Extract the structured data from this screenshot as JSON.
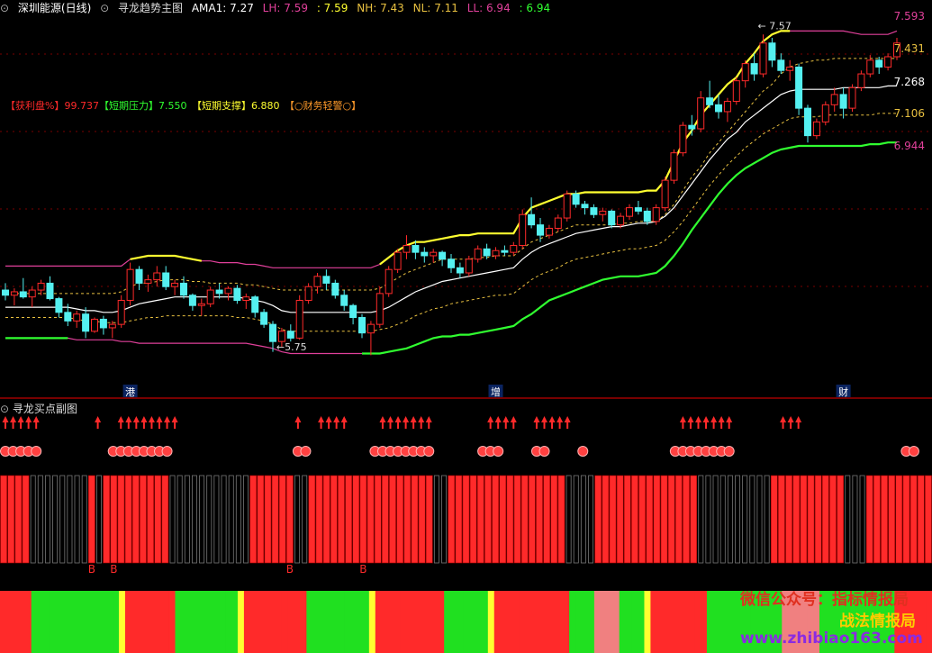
{
  "header": {
    "stock_name": "深圳能源",
    "period": "(日线)",
    "indicator_name": "寻龙趋势主图",
    "ama1_label": "AMA1:",
    "ama1_value": "7.27",
    "lh_label": "LH:",
    "lh_value": "7.59",
    "val2": ": 7.59",
    "nh_label": "NH:",
    "nh_value": "7.43",
    "nl_label": "NL:",
    "nl_value": "7.11",
    "ll_label": "LL:",
    "ll_value": "6.94",
    "val6": ": 6.94"
  },
  "indicators": {
    "profit_label": "【获利盘%】",
    "profit_value": "99.737",
    "pressure_label": "【短期压力】",
    "pressure_value": "7.550",
    "support_label": "【短期支撑】",
    "support_value": "6.880",
    "finance_label": "【○财务轻警○】"
  },
  "sub_panel": {
    "title": "寻龙买点副图"
  },
  "colors": {
    "up": "#ff2a2a",
    "down": "#54f0f0",
    "yellow": "#ffff30",
    "green": "#30ff30",
    "magenta": "#e0409a",
    "white": "#ffffff",
    "gold": "#e8c040",
    "pink": "#f08080",
    "darkred": "#a80000"
  },
  "chart_data": {
    "type": "candlestick",
    "price_range": [
      5.55,
      7.65
    ],
    "right_axis_labels": [
      "7.593",
      "7.431",
      "7.268",
      "7.106",
      "6.944"
    ],
    "annotations": [
      {
        "text": "7.57",
        "index": 85,
        "price": 7.62
      },
      {
        "text": "5.75",
        "index": 31,
        "price": 5.75
      }
    ],
    "event_markers": [
      {
        "text": "港",
        "index": 14
      },
      {
        "text": "增",
        "index": 55
      },
      {
        "text": "财",
        "index": 94
      }
    ],
    "ohlc": [
      [
        6.08,
        6.12,
        6.02,
        6.05
      ],
      [
        6.05,
        6.09,
        5.99,
        6.07
      ],
      [
        6.07,
        6.15,
        6.03,
        6.04
      ],
      [
        6.04,
        6.1,
        5.98,
        6.08
      ],
      [
        6.08,
        6.14,
        6.05,
        6.12
      ],
      [
        6.12,
        6.16,
        6.02,
        6.03
      ],
      [
        6.03,
        6.04,
        5.92,
        5.95
      ],
      [
        5.95,
        6.0,
        5.87,
        5.9
      ],
      [
        5.9,
        5.96,
        5.86,
        5.94
      ],
      [
        5.94,
        5.98,
        5.8,
        5.84
      ],
      [
        5.84,
        5.92,
        5.83,
        5.91
      ],
      [
        5.91,
        5.93,
        5.82,
        5.86
      ],
      [
        5.86,
        5.9,
        5.8,
        5.88
      ],
      [
        5.88,
        6.05,
        5.86,
        6.02
      ],
      [
        6.02,
        6.24,
        5.99,
        6.2
      ],
      [
        6.2,
        6.22,
        6.08,
        6.12
      ],
      [
        6.12,
        6.17,
        6.07,
        6.14
      ],
      [
        6.14,
        6.22,
        6.1,
        6.18
      ],
      [
        6.18,
        6.22,
        6.08,
        6.1
      ],
      [
        6.1,
        6.14,
        6.05,
        6.12
      ],
      [
        6.12,
        6.16,
        6.03,
        6.05
      ],
      [
        6.05,
        6.06,
        5.96,
        5.99
      ],
      [
        5.99,
        6.03,
        5.93,
        6.0
      ],
      [
        6.0,
        6.1,
        5.98,
        6.08
      ],
      [
        6.08,
        6.12,
        6.03,
        6.06
      ],
      [
        6.06,
        6.1,
        6.02,
        6.09
      ],
      [
        6.09,
        6.11,
        6.0,
        6.02
      ],
      [
        6.02,
        6.06,
        5.97,
        6.04
      ],
      [
        6.04,
        6.05,
        5.92,
        5.95
      ],
      [
        5.95,
        5.97,
        5.86,
        5.88
      ],
      [
        5.88,
        5.9,
        5.72,
        5.78
      ],
      [
        5.78,
        5.86,
        5.75,
        5.84
      ],
      [
        5.84,
        5.88,
        5.78,
        5.8
      ],
      [
        5.8,
        6.05,
        5.79,
        6.02
      ],
      [
        6.02,
        6.12,
        6.0,
        6.1
      ],
      [
        6.1,
        6.18,
        6.06,
        6.16
      ],
      [
        6.16,
        6.2,
        6.08,
        6.12
      ],
      [
        6.12,
        6.14,
        6.03,
        6.05
      ],
      [
        6.05,
        6.08,
        5.96,
        5.99
      ],
      [
        5.99,
        6.0,
        5.88,
        5.92
      ],
      [
        5.92,
        5.94,
        5.8,
        5.83
      ],
      [
        5.83,
        5.9,
        5.7,
        5.88
      ],
      [
        5.88,
        6.1,
        5.86,
        6.06
      ],
      [
        6.06,
        6.22,
        6.04,
        6.2
      ],
      [
        6.2,
        6.32,
        6.18,
        6.3
      ],
      [
        6.3,
        6.4,
        6.26,
        6.34
      ],
      [
        6.34,
        6.37,
        6.26,
        6.3
      ],
      [
        6.3,
        6.33,
        6.24,
        6.28
      ],
      [
        6.28,
        6.32,
        6.24,
        6.3
      ],
      [
        6.3,
        6.31,
        6.22,
        6.26
      ],
      [
        6.26,
        6.29,
        6.18,
        6.21
      ],
      [
        6.21,
        6.24,
        6.15,
        6.18
      ],
      [
        6.18,
        6.28,
        6.16,
        6.26
      ],
      [
        6.26,
        6.34,
        6.24,
        6.32
      ],
      [
        6.32,
        6.35,
        6.26,
        6.28
      ],
      [
        6.28,
        6.33,
        6.26,
        6.31
      ],
      [
        6.31,
        6.34,
        6.28,
        6.3
      ],
      [
        6.3,
        6.36,
        6.28,
        6.34
      ],
      [
        6.34,
        6.55,
        6.32,
        6.52
      ],
      [
        6.52,
        6.62,
        6.44,
        6.46
      ],
      [
        6.46,
        6.5,
        6.36,
        6.4
      ],
      [
        6.4,
        6.46,
        6.38,
        6.44
      ],
      [
        6.44,
        6.52,
        6.42,
        6.5
      ],
      [
        6.5,
        6.66,
        6.48,
        6.64
      ],
      [
        6.64,
        6.66,
        6.56,
        6.58
      ],
      [
        6.58,
        6.6,
        6.52,
        6.56
      ],
      [
        6.56,
        6.58,
        6.5,
        6.52
      ],
      [
        6.52,
        6.56,
        6.48,
        6.54
      ],
      [
        6.54,
        6.55,
        6.44,
        6.46
      ],
      [
        6.46,
        6.53,
        6.44,
        6.51
      ],
      [
        6.51,
        6.58,
        6.49,
        6.56
      ],
      [
        6.56,
        6.6,
        6.52,
        6.54
      ],
      [
        6.54,
        6.56,
        6.46,
        6.48
      ],
      [
        6.48,
        6.58,
        6.46,
        6.56
      ],
      [
        6.56,
        6.74,
        6.54,
        6.72
      ],
      [
        6.72,
        6.9,
        6.7,
        6.88
      ],
      [
        6.88,
        7.06,
        6.86,
        7.04
      ],
      [
        7.04,
        7.1,
        6.98,
        7.02
      ],
      [
        7.02,
        7.24,
        7.0,
        7.2
      ],
      [
        7.2,
        7.3,
        7.14,
        7.16
      ],
      [
        7.16,
        7.22,
        7.08,
        7.12
      ],
      [
        7.12,
        7.2,
        7.06,
        7.18
      ],
      [
        7.18,
        7.32,
        7.16,
        7.3
      ],
      [
        7.3,
        7.42,
        7.26,
        7.4
      ],
      [
        7.4,
        7.46,
        7.3,
        7.34
      ],
      [
        7.34,
        7.57,
        7.32,
        7.52
      ],
      [
        7.52,
        7.55,
        7.38,
        7.42
      ],
      [
        7.42,
        7.46,
        7.34,
        7.36
      ],
      [
        7.36,
        7.42,
        7.3,
        7.38
      ],
      [
        7.38,
        7.4,
        7.1,
        7.14
      ],
      [
        7.14,
        7.16,
        6.94,
        6.98
      ],
      [
        6.98,
        7.08,
        6.96,
        7.06
      ],
      [
        7.06,
        7.18,
        7.04,
        7.16
      ],
      [
        7.16,
        7.26,
        7.12,
        7.22
      ],
      [
        7.22,
        7.26,
        7.08,
        7.14
      ],
      [
        7.14,
        7.28,
        7.12,
        7.26
      ],
      [
        7.26,
        7.36,
        7.24,
        7.34
      ],
      [
        7.34,
        7.45,
        7.32,
        7.42
      ],
      [
        7.42,
        7.44,
        7.34,
        7.38
      ],
      [
        7.38,
        7.46,
        7.36,
        7.44
      ],
      [
        7.44,
        7.55,
        7.42,
        7.52
      ]
    ],
    "bands": {
      "lh": [
        6.22,
        6.22,
        6.22,
        6.22,
        6.22,
        6.22,
        6.22,
        6.22,
        6.22,
        6.22,
        6.22,
        6.22,
        6.22,
        6.22,
        6.26,
        6.27,
        6.28,
        6.28,
        6.28,
        6.28,
        6.27,
        6.26,
        6.25,
        6.25,
        6.24,
        6.24,
        6.24,
        6.23,
        6.23,
        6.22,
        6.21,
        6.21,
        6.21,
        6.21,
        6.21,
        6.21,
        6.21,
        6.21,
        6.21,
        6.21,
        6.21,
        6.21,
        6.23,
        6.27,
        6.31,
        6.34,
        6.36,
        6.36,
        6.37,
        6.38,
        6.39,
        6.4,
        6.4,
        6.41,
        6.41,
        6.41,
        6.41,
        6.41,
        6.5,
        6.56,
        6.58,
        6.6,
        6.62,
        6.64,
        6.64,
        6.65,
        6.65,
        6.65,
        6.65,
        6.65,
        6.65,
        6.65,
        6.66,
        6.66,
        6.72,
        6.83,
        6.94,
        7.01,
        7.1,
        7.16,
        7.22,
        7.28,
        7.32,
        7.4,
        7.46,
        7.53,
        7.57,
        7.59,
        7.59,
        7.59,
        7.59,
        7.59,
        7.59,
        7.59,
        7.59,
        7.58,
        7.57,
        7.57,
        7.57,
        7.57,
        7.59
      ],
      "nh": [
        6.06,
        6.06,
        6.06,
        6.06,
        6.06,
        6.06,
        6.06,
        6.06,
        6.06,
        6.06,
        6.06,
        6.06,
        6.06,
        6.07,
        6.1,
        6.12,
        6.12,
        6.13,
        6.14,
        6.14,
        6.14,
        6.13,
        6.13,
        6.12,
        6.12,
        6.12,
        6.12,
        6.11,
        6.11,
        6.1,
        6.09,
        6.08,
        6.08,
        6.08,
        6.08,
        6.08,
        6.08,
        6.08,
        6.08,
        6.08,
        6.08,
        6.08,
        6.09,
        6.12,
        6.15,
        6.18,
        6.2,
        6.22,
        6.24,
        6.26,
        6.26,
        6.26,
        6.26,
        6.27,
        6.27,
        6.28,
        6.28,
        6.28,
        6.32,
        6.36,
        6.38,
        6.4,
        6.42,
        6.44,
        6.46,
        6.46,
        6.46,
        6.46,
        6.46,
        6.47,
        6.47,
        6.48,
        6.48,
        6.48,
        6.52,
        6.58,
        6.66,
        6.74,
        6.8,
        6.88,
        6.94,
        7.0,
        7.06,
        7.12,
        7.18,
        7.24,
        7.28,
        7.34,
        7.38,
        7.4,
        7.41,
        7.42,
        7.42,
        7.43,
        7.43,
        7.43,
        7.43,
        7.43,
        7.43,
        7.43,
        7.43
      ],
      "ama": [
        5.98,
        5.98,
        5.98,
        5.98,
        5.98,
        5.98,
        5.98,
        5.98,
        5.97,
        5.96,
        5.96,
        5.95,
        5.95,
        5.96,
        5.98,
        6.0,
        6.01,
        6.02,
        6.03,
        6.04,
        6.04,
        6.04,
        6.04,
        6.04,
        6.04,
        6.04,
        6.04,
        6.03,
        6.02,
        6.01,
        5.99,
        5.96,
        5.95,
        5.95,
        5.95,
        5.95,
        5.95,
        5.95,
        5.95,
        5.95,
        5.95,
        5.95,
        5.96,
        5.98,
        6.01,
        6.04,
        6.07,
        6.09,
        6.11,
        6.13,
        6.14,
        6.15,
        6.16,
        6.17,
        6.18,
        6.19,
        6.2,
        6.21,
        6.26,
        6.3,
        6.33,
        6.35,
        6.37,
        6.39,
        6.41,
        6.42,
        6.43,
        6.44,
        6.45,
        6.45,
        6.46,
        6.47,
        6.47,
        6.48,
        6.51,
        6.56,
        6.63,
        6.7,
        6.77,
        6.84,
        6.9,
        6.96,
        7.0,
        7.06,
        7.1,
        7.14,
        7.18,
        7.22,
        7.24,
        7.25,
        7.25,
        7.25,
        7.25,
        7.25,
        7.26,
        7.26,
        7.26,
        7.26,
        7.26,
        7.27,
        7.27
      ],
      "nl": [
        5.92,
        5.92,
        5.92,
        5.92,
        5.92,
        5.92,
        5.92,
        5.92,
        5.91,
        5.9,
        5.9,
        5.89,
        5.89,
        5.89,
        5.9,
        5.91,
        5.92,
        5.92,
        5.93,
        5.93,
        5.93,
        5.93,
        5.93,
        5.93,
        5.93,
        5.93,
        5.92,
        5.92,
        5.91,
        5.9,
        5.88,
        5.85,
        5.84,
        5.84,
        5.84,
        5.84,
        5.84,
        5.84,
        5.84,
        5.84,
        5.84,
        5.84,
        5.85,
        5.86,
        5.88,
        5.9,
        5.93,
        5.95,
        5.97,
        5.98,
        6.0,
        6.01,
        6.02,
        6.03,
        6.04,
        6.05,
        6.05,
        6.06,
        6.1,
        6.14,
        6.17,
        6.19,
        6.21,
        6.24,
        6.26,
        6.27,
        6.28,
        6.29,
        6.3,
        6.31,
        6.32,
        6.32,
        6.33,
        6.34,
        6.37,
        6.42,
        6.48,
        6.55,
        6.62,
        6.69,
        6.75,
        6.81,
        6.86,
        6.91,
        6.95,
        6.99,
        7.02,
        7.05,
        7.08,
        7.09,
        7.09,
        7.09,
        7.1,
        7.1,
        7.1,
        7.1,
        7.1,
        7.1,
        7.11,
        7.11,
        7.11
      ],
      "ll": [
        5.8,
        5.8,
        5.8,
        5.8,
        5.8,
        5.8,
        5.8,
        5.8,
        5.79,
        5.79,
        5.79,
        5.79,
        5.79,
        5.78,
        5.78,
        5.77,
        5.77,
        5.77,
        5.77,
        5.77,
        5.77,
        5.77,
        5.77,
        5.77,
        5.77,
        5.77,
        5.77,
        5.77,
        5.76,
        5.75,
        5.74,
        5.72,
        5.71,
        5.71,
        5.71,
        5.71,
        5.71,
        5.71,
        5.71,
        5.71,
        5.71,
        5.71,
        5.71,
        5.72,
        5.73,
        5.74,
        5.76,
        5.78,
        5.8,
        5.81,
        5.81,
        5.82,
        5.82,
        5.83,
        5.84,
        5.85,
        5.86,
        5.87,
        5.91,
        5.94,
        5.98,
        6.02,
        6.04,
        6.06,
        6.08,
        6.1,
        6.12,
        6.14,
        6.15,
        6.16,
        6.16,
        6.16,
        6.17,
        6.18,
        6.22,
        6.28,
        6.35,
        6.43,
        6.5,
        6.57,
        6.64,
        6.7,
        6.75,
        6.79,
        6.82,
        6.85,
        6.88,
        6.9,
        6.91,
        6.92,
        6.92,
        6.92,
        6.92,
        6.92,
        6.92,
        6.92,
        6.92,
        6.93,
        6.93,
        6.94,
        6.94
      ]
    },
    "buy_arrows": [
      0,
      1,
      2,
      3,
      4,
      12,
      15,
      16,
      17,
      18,
      19,
      20,
      21,
      22,
      38,
      41,
      42,
      43,
      44,
      49,
      50,
      51,
      52,
      53,
      54,
      55,
      63,
      64,
      65,
      66,
      69,
      70,
      71,
      72,
      73,
      88,
      89,
      90,
      91,
      92,
      93,
      94,
      101,
      102,
      103
    ],
    "signal_balls": [
      0,
      1,
      2,
      3,
      4,
      14,
      15,
      16,
      17,
      18,
      19,
      20,
      21,
      38,
      39,
      48,
      49,
      50,
      51,
      52,
      53,
      54,
      55,
      62,
      63,
      64,
      69,
      70,
      75,
      87,
      88,
      89,
      90,
      91,
      92,
      93,
      94,
      117,
      118
    ],
    "bar_states": "RRRRGGGGGGGGRGRRRRRRRRRGGGGGGGGGGGRRRRRRGGRRRRRRRRRRRRRRRRRGGRRRRRRRRRRRRRRRRGGGGRRRRRRRRRRRRRRGGGGGGGGGGRRRRRRRRRRGGGRRRRRRRRR",
    "b_labels": [
      {
        "text": "B",
        "index": 12
      },
      {
        "text": "B",
        "index": 15
      },
      {
        "text": "B",
        "index": 39
      },
      {
        "text": "B",
        "index": 49
      }
    ],
    "bottom_strip": "RRRRRGGGGGGGGGGGGGGYRRRRRRRRGGGGGGGGGGYRRRRRRRRRRGGGGGGGGGGYRRRRRRRRRRRGGGGGGGYRRRRRRRRRRRRGGGGPPPPGGGGYRRRRRRRRRGGGGGGGGGGGGPPPPPPGGGGGGGGGGGGRRRRRR"
  },
  "watermark": {
    "line1": "微信公众号：指标情报局",
    "line2": "战法情报局",
    "line3": "www.zhibiao163.com"
  }
}
